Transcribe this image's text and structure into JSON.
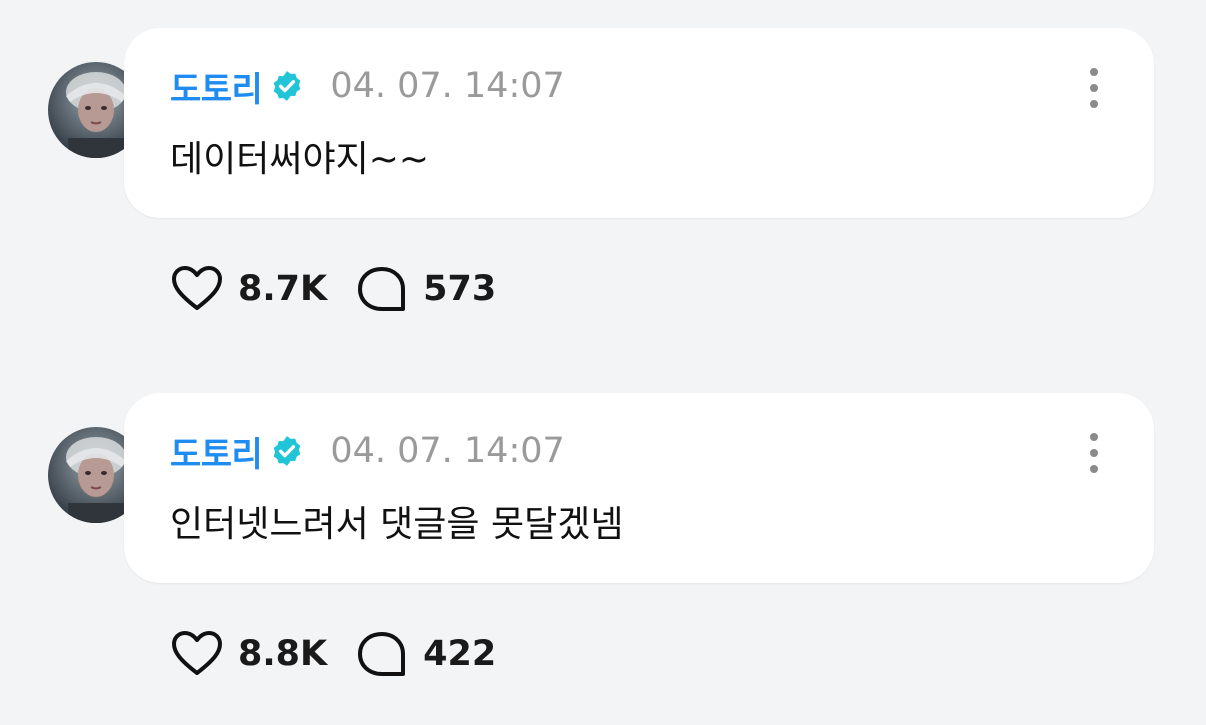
{
  "comments": [
    {
      "author": "도토리",
      "verified_icon": "verified-badge-icon",
      "timestamp": "04. 07. 14:07",
      "text": "데이터써야지~~",
      "likes": "8.7K",
      "replies": "573"
    },
    {
      "author": "도토리",
      "verified_icon": "verified-badge-icon",
      "timestamp": "04. 07. 14:07",
      "text": "인터넷느려서 댓글을 못달겠넴",
      "likes": "8.8K",
      "replies": "422"
    }
  ],
  "colors": {
    "author": "#1e8cf0",
    "verified": "#22c4d8",
    "timestamp": "#9a9a9a",
    "background": "#f3f4f6",
    "bubble": "#ffffff"
  }
}
